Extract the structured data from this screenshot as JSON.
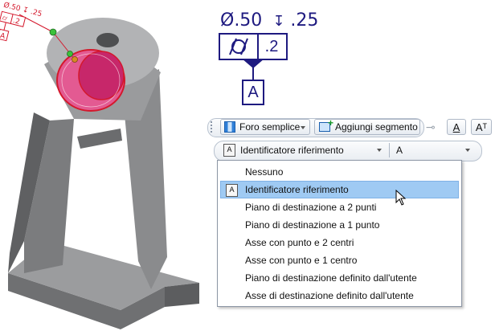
{
  "model": {
    "small_annotation": {
      "diameter": "Ø.50",
      "depth_symbol": "↧",
      "depth": ".25",
      "tolerance": ".2",
      "datum": "A"
    },
    "colors": {
      "body": "#8d8e90",
      "highlight": "#e0226a",
      "annotation": "#d4182c"
    }
  },
  "fcf": {
    "diameter_text": "Ø.50",
    "depth_symbol": "↧",
    "depth_text": ".25",
    "tolerance": ".2",
    "datum": "A",
    "color": "#1e1a80"
  },
  "toolbar": {
    "hole_type": "Foro semplice",
    "add_segment": "Aggiungi segmento"
  },
  "identifier_row": {
    "selected": "Identificatore riferimento",
    "value": "A"
  },
  "dropdown": {
    "items": [
      {
        "label": "Nessuno",
        "icon": ""
      },
      {
        "label": "Identificatore riferimento",
        "icon": "datum-identifier-icon"
      },
      {
        "label": "Piano di destinazione a 2 punti",
        "icon": ""
      },
      {
        "label": "Piano di destinazione a 1 punto",
        "icon": ""
      },
      {
        "label": "Asse con punto e 2 centri",
        "icon": ""
      },
      {
        "label": "Asse con punto e 1 centro",
        "icon": ""
      },
      {
        "label": "Piano di destinazione definito dall'utente",
        "icon": ""
      },
      {
        "label": "Asse di destinazione definito dall'utente",
        "icon": ""
      }
    ],
    "selected_index": 1
  }
}
